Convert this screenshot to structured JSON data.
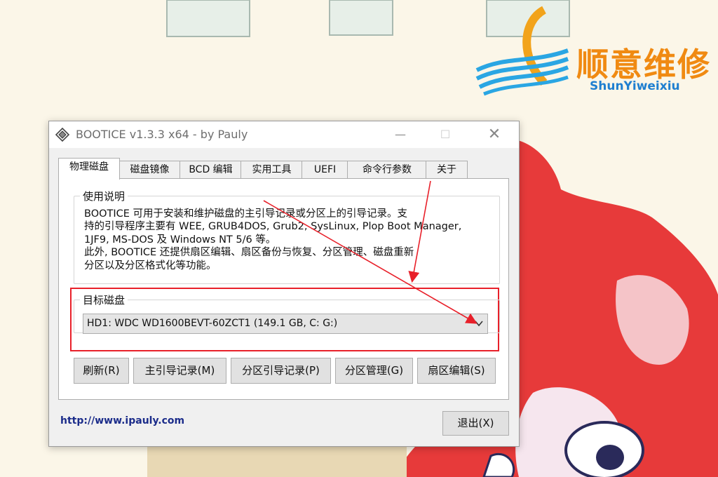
{
  "watermark": {
    "brand_cn": "顺意维修",
    "brand_en": "ShunYiweixiu"
  },
  "window": {
    "title": "BOOTICE v1.3.3 x64 - by Pauly",
    "icon": "bootice-app-icon",
    "minimize_glyph": "—",
    "maximize_glyph": "☐",
    "close_glyph": "✕"
  },
  "tabs": [
    {
      "label": "物理磁盘",
      "active": true
    },
    {
      "label": "磁盘镜像"
    },
    {
      "label": "BCD 编辑"
    },
    {
      "label": "实用工具"
    },
    {
      "label": "UEFI"
    },
    {
      "label": "命令行参数"
    },
    {
      "label": "关于"
    }
  ],
  "usage": {
    "title": "使用说明",
    "text": "BOOTICE 可用于安装和维护磁盘的主引导记录或分区上的引导记录。支\n持的引导程序主要有 WEE, GRUB4DOS, Grub2, SysLinux, Plop Boot Manager,\n1JF9, MS-DOS 及 Windows NT 5/6 等。\n此外, BOOTICE 还提供扇区编辑、扇区备份与恢复、分区管理、磁盘重新\n分区以及分区格式化等功能。"
  },
  "target_disk": {
    "title": "目标磁盘",
    "selected": "HD1: WDC WD1600BEVT-60ZCT1 (149.1 GB, C: G:)"
  },
  "buttons": {
    "refresh": "刷新(R)",
    "mbr": "主引导记录(M)",
    "pbr": "分区引导记录(P)",
    "parts": "分区管理(G)",
    "sector": "扇区编辑(S)",
    "exit": "退出(X)"
  },
  "footer": {
    "url": "http://www.ipauly.com"
  },
  "colors": {
    "highlight": "#e8202a",
    "brand_orange": "#f08a12",
    "brand_blue": "#1f7fd0",
    "link": "#1b2c8a"
  }
}
